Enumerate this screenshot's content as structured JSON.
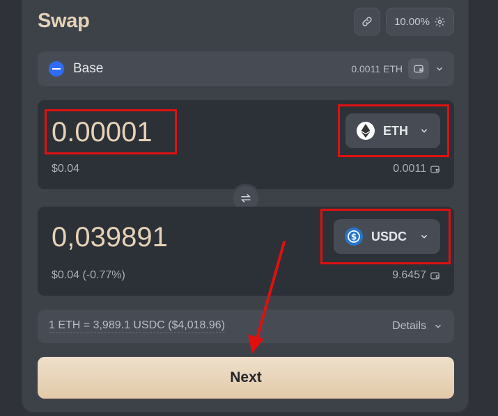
{
  "header": {
    "title": "Swap",
    "slippage": "10.00%"
  },
  "network": {
    "name": "Base",
    "balance": "0.0011 ETH"
  },
  "from": {
    "amount": "0.00001",
    "usd": "$0.04",
    "token": "ETH",
    "balance": "0.0011"
  },
  "to": {
    "amount": "0,039891",
    "usd": "$0.04 (-0.77%)",
    "token": "USDC",
    "balance": "9.6457"
  },
  "rate": {
    "text": "1 ETH = 3,989.1 USDC ($4,018.96)",
    "details_label": "Details"
  },
  "actions": {
    "next_label": "Next"
  },
  "icons": [
    "link-icon",
    "gear-icon",
    "base-network-icon",
    "wallet-icon",
    "chevron-down-icon",
    "eth-token-icon",
    "usdc-token-icon",
    "swap-arrows-icon"
  ],
  "colors": {
    "accent": "#e6d2b7",
    "annotation": "#e01010",
    "network": "#2f6cf5",
    "usdc": "#2775ca"
  }
}
